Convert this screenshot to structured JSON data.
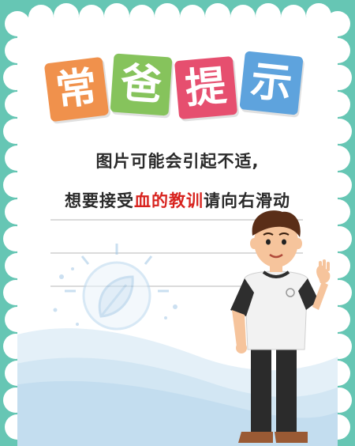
{
  "title": {
    "chars": [
      "常",
      "爸",
      "提",
      "示"
    ],
    "colors": [
      "#f0914c",
      "#86c35c",
      "#e64f6f",
      "#5ea3dd"
    ]
  },
  "message": {
    "line1": "图片可能会引起不适,",
    "line2_prefix": "想要接受",
    "line2_highlight": "血的教训",
    "line2_suffix": "请向右滑动"
  },
  "colors": {
    "background": "#66c6b4",
    "card": "#ffffff",
    "ground": "#d7eaf6",
    "highlight": "#d8231e"
  }
}
